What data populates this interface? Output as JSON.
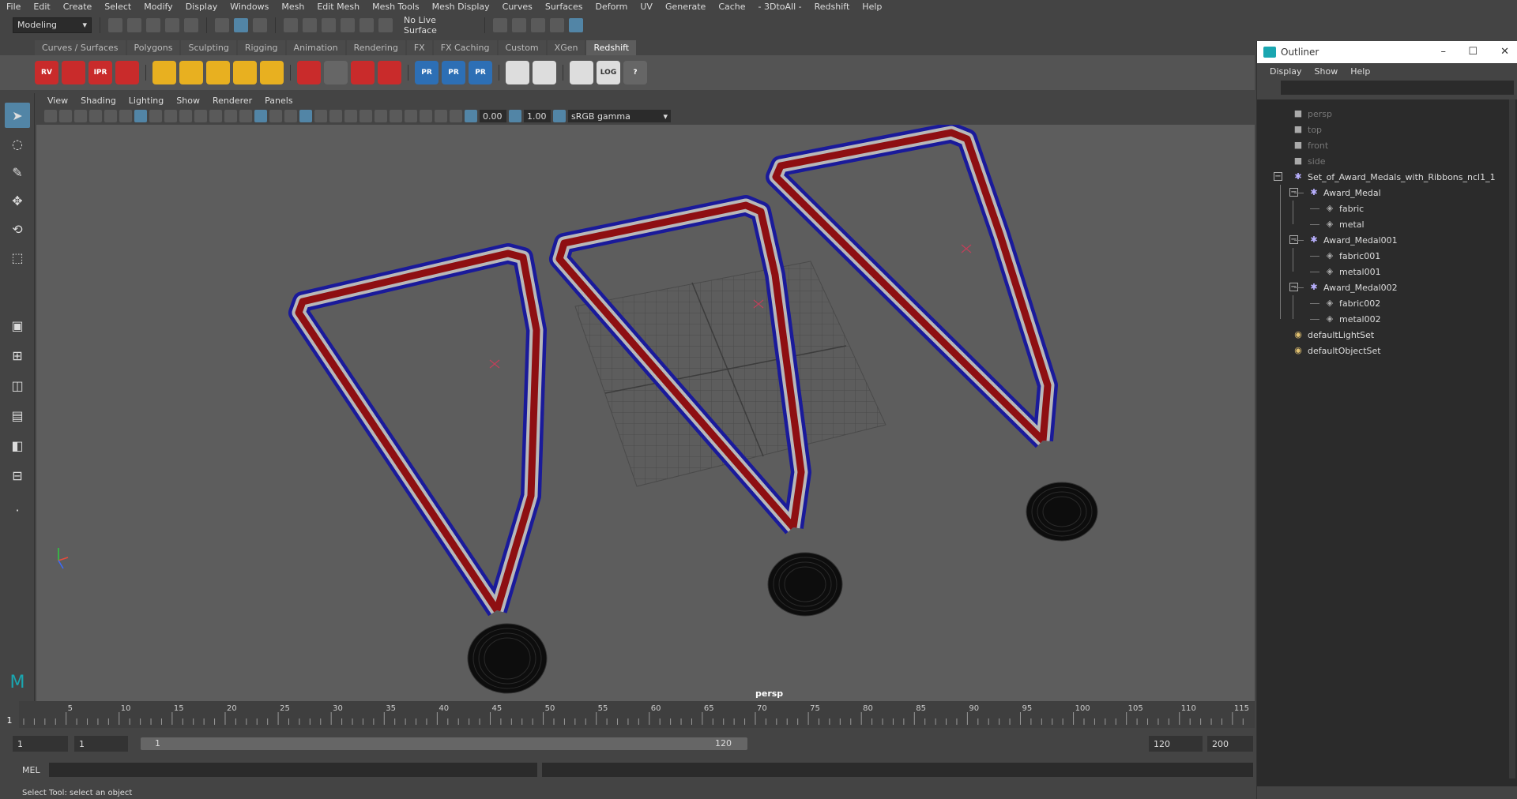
{
  "menus": [
    "File",
    "Edit",
    "Create",
    "Select",
    "Modify",
    "Display",
    "Windows",
    "Mesh",
    "Edit Mesh",
    "Mesh Tools",
    "Mesh Display",
    "Curves",
    "Surfaces",
    "Deform",
    "UV",
    "Generate",
    "Cache",
    "- 3DtoAll -",
    "Redshift",
    "Help"
  ],
  "status": {
    "mode": "Modeling",
    "live_surface": "No Live Surface"
  },
  "shelf": {
    "tabs": [
      "Curves / Surfaces",
      "Polygons",
      "Sculpting",
      "Rigging",
      "Animation",
      "Rendering",
      "FX",
      "FX Caching",
      "Custom",
      "XGen",
      "Redshift"
    ],
    "active_tab": "Redshift",
    "icon_labels": {
      "rv": "RV",
      "ipr": "IPR",
      "pr": "PR",
      "log": "LOG",
      "help": "?"
    }
  },
  "panel": {
    "menus": [
      "View",
      "Shading",
      "Lighting",
      "Show",
      "Renderer",
      "Panels"
    ],
    "exposure": "0.00",
    "gamma": "1.00",
    "colorspace": "sRGB gamma",
    "camera_label": "persp"
  },
  "timeline": {
    "ticks": [
      1,
      5,
      10,
      15,
      20,
      25,
      30,
      35,
      40,
      45,
      50,
      55,
      60,
      65,
      70,
      75,
      80,
      85,
      90,
      95,
      100,
      105,
      110,
      115
    ],
    "current_frame": "1",
    "range_start": "1",
    "playback_start": "1",
    "slider_start": "1",
    "slider_end": "120",
    "playback_end": "120",
    "range_end": "200"
  },
  "cmd": {
    "label": "MEL"
  },
  "help_line": "Select Tool: select an object",
  "outliner": {
    "title": "Outliner",
    "menus": [
      "Display",
      "Show",
      "Help"
    ],
    "items": [
      {
        "label": "persp",
        "type": "camera",
        "depth": 0,
        "dim": true
      },
      {
        "label": "top",
        "type": "camera",
        "depth": 0,
        "dim": true
      },
      {
        "label": "front",
        "type": "camera",
        "depth": 0,
        "dim": true
      },
      {
        "label": "side",
        "type": "camera",
        "depth": 0,
        "dim": true
      },
      {
        "label": "Set_of_Award_Medals_with_Ribbons_ncl1_1",
        "type": "group",
        "depth": 0,
        "expanded": true
      },
      {
        "label": "Award_Medal",
        "type": "group",
        "depth": 1,
        "expanded": true
      },
      {
        "label": "fabric",
        "type": "mesh",
        "depth": 2
      },
      {
        "label": "metal",
        "type": "mesh",
        "depth": 2
      },
      {
        "label": "Award_Medal001",
        "type": "group",
        "depth": 1,
        "expanded": true
      },
      {
        "label": "fabric001",
        "type": "mesh",
        "depth": 2
      },
      {
        "label": "metal001",
        "type": "mesh",
        "depth": 2
      },
      {
        "label": "Award_Medal002",
        "type": "group",
        "depth": 1,
        "expanded": true
      },
      {
        "label": "fabric002",
        "type": "mesh",
        "depth": 2
      },
      {
        "label": "metal002",
        "type": "mesh",
        "depth": 2
      },
      {
        "label": "defaultLightSet",
        "type": "set",
        "depth": 0
      },
      {
        "label": "defaultObjectSet",
        "type": "set",
        "depth": 0
      }
    ]
  },
  "colors": {
    "ribbon_red": "#8e0f12",
    "ribbon_white": "#b8b8b8",
    "ribbon_blue": "#1a1a9a",
    "medal": "#0d0d0d",
    "viewport_bg": "#5d5d5d",
    "accent": "#5285a6"
  }
}
